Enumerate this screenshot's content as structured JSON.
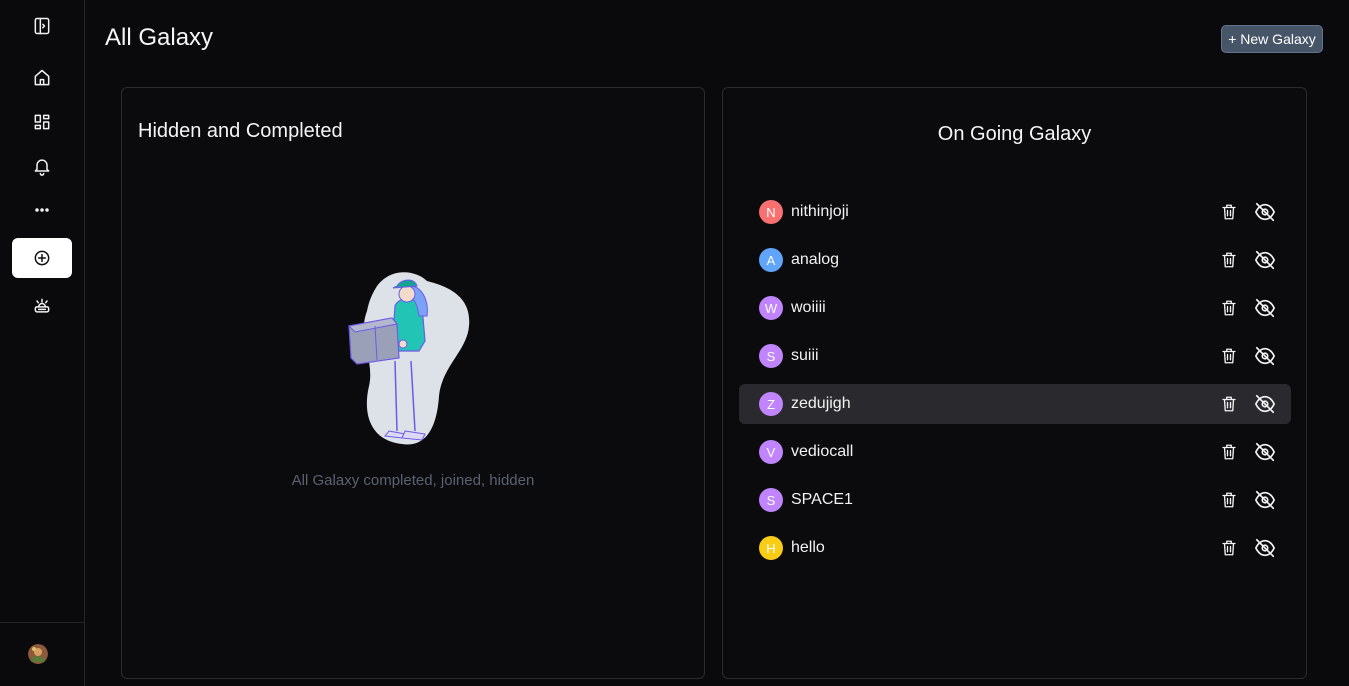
{
  "header": {
    "title": "All Galaxy",
    "new_button": "+ New Galaxy"
  },
  "sidebar": {
    "items": [
      {
        "name": "sidebar-toggle",
        "icon": "panel-toggle-icon"
      },
      {
        "name": "home",
        "icon": "home-icon"
      },
      {
        "name": "dashboard",
        "icon": "dashboard-icon"
      },
      {
        "name": "notifications",
        "icon": "bell-icon"
      },
      {
        "name": "more",
        "icon": "more-icon"
      },
      {
        "name": "create",
        "icon": "plus-circle-icon",
        "active": true
      },
      {
        "name": "galaxy",
        "icon": "galaxy-icon"
      }
    ]
  },
  "hidden_panel": {
    "title": "Hidden and Completed",
    "empty_text": "All Galaxy completed, joined, hidden"
  },
  "ongoing_panel": {
    "title": "On Going Galaxy",
    "items": [
      {
        "letter": "N",
        "name": "nithinjoji",
        "color": "#f87171"
      },
      {
        "letter": "A",
        "name": "analog",
        "color": "#60a5fa"
      },
      {
        "letter": "W",
        "name": "woiiii",
        "color": "#c084fc"
      },
      {
        "letter": "S",
        "name": "suiii",
        "color": "#c084fc"
      },
      {
        "letter": "Z",
        "name": "zedujigh",
        "color": "#c084fc"
      },
      {
        "letter": "V",
        "name": "vediocall",
        "color": "#c084fc"
      },
      {
        "letter": "S",
        "name": "SPACE1",
        "color": "#c084fc"
      },
      {
        "letter": "H",
        "name": "hello",
        "color": "#facc15"
      }
    ],
    "selected_index": 4
  },
  "colors": {
    "accent_button": "#475569",
    "background": "#0a0a0c",
    "panel_border": "#2a2a2f",
    "row_selected": "#2a2a2e"
  }
}
